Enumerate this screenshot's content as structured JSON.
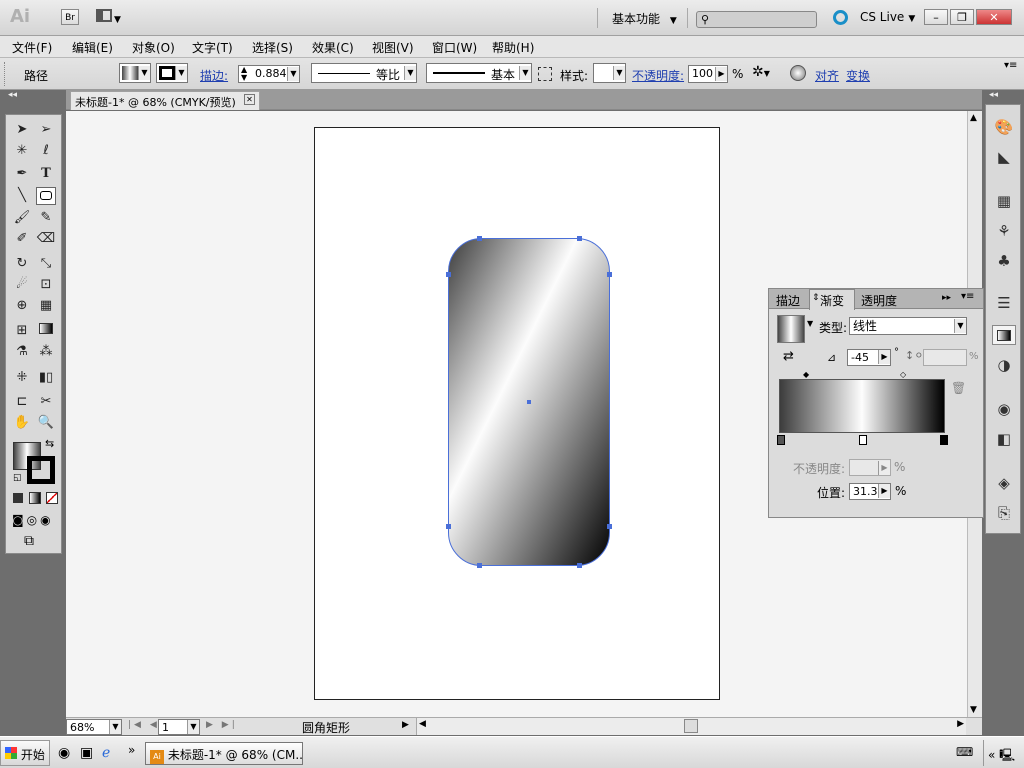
{
  "app": {
    "logo": "Ai",
    "bridge": "Br",
    "workspace": "基本功能",
    "cslive": "CS Live"
  },
  "menu": [
    "文件(F)",
    "编辑(E)",
    "对象(O)",
    "文字(T)",
    "选择(S)",
    "效果(C)",
    "视图(V)",
    "窗口(W)",
    "帮助(H)"
  ],
  "control": {
    "object_type": "路径",
    "stroke_label": "描边:",
    "stroke_weight": "0.884",
    "profile_label": "等比",
    "brush_label": "基本",
    "style_label": "样式:",
    "opacity_label": "不透明度:",
    "opacity_value": "100",
    "opacity_unit": "%",
    "align_label": "对齐",
    "transform_label": "变换"
  },
  "document": {
    "tab_title": "未标题-1* @ 68% (CMYK/预览)"
  },
  "status": {
    "zoom": "68%",
    "page": "1",
    "tool_name": "圆角矩形"
  },
  "gradient_panel": {
    "tabs": [
      "描边",
      "渐变",
      "透明度"
    ],
    "type_label": "类型:",
    "type_value": "线性",
    "angle": "-45",
    "angle_unit": "°",
    "aspect_unit": "%",
    "opacity_label": "不透明度:",
    "opacity_unit": "%",
    "location_label": "位置:",
    "location_value": "31.33",
    "location_unit": "%"
  },
  "taskbar": {
    "start": "开始",
    "task": "未标题-1* @ 68% (CM..."
  },
  "colors": {
    "selection": "#4a6fd8",
    "link": "#1f3fb0"
  }
}
